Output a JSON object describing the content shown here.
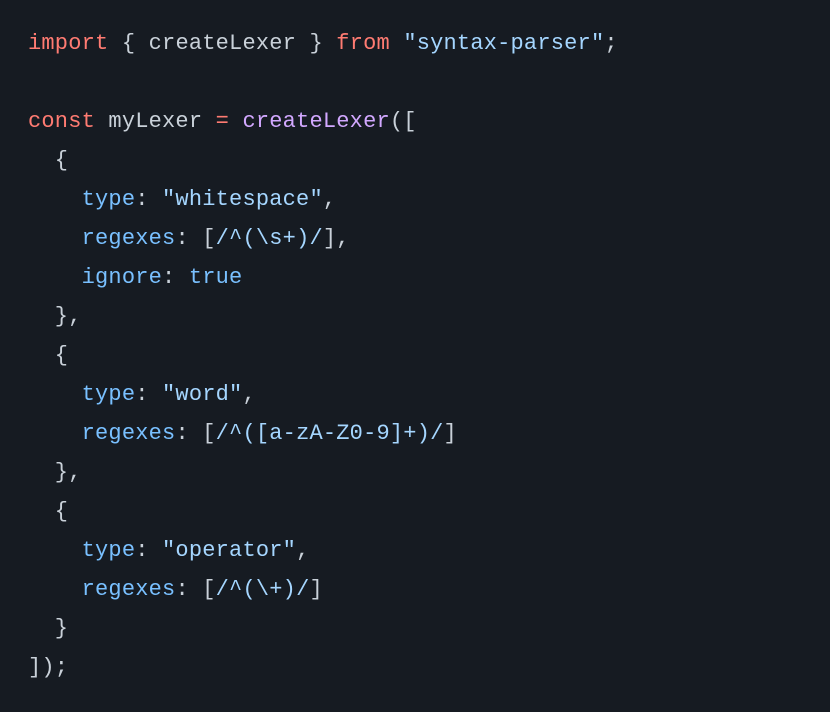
{
  "tokens": {
    "t0": "import",
    "t1": " { ",
    "t2": "createLexer",
    "t3": " } ",
    "t4": "from",
    "t5": " ",
    "t6": "\"syntax-parser\"",
    "t7": ";",
    "t8": "",
    "t9": "const",
    "t10": " ",
    "t11": "myLexer",
    "t12": " ",
    "t13": "=",
    "t14": " ",
    "t15": "createLexer",
    "t16": "([",
    "t17": "  {",
    "t18": "    ",
    "t19": "type",
    "t20": ": ",
    "t21": "\"whitespace\"",
    "t22": ",",
    "t23": "    ",
    "t24": "regexes",
    "t25": ": [",
    "t26": "/^(\\s+)/",
    "t27": "],",
    "t28": "    ",
    "t29": "ignore",
    "t30": ": ",
    "t31": "true",
    "t32": "  },",
    "t33": "  {",
    "t34": "    ",
    "t35": "type",
    "t36": ": ",
    "t37": "\"word\"",
    "t38": ",",
    "t39": "    ",
    "t40": "regexes",
    "t41": ": [",
    "t42": "/^([a-zA-Z0-9]+)/",
    "t43": "]",
    "t44": "  },",
    "t45": "  {",
    "t46": "    ",
    "t47": "type",
    "t48": ": ",
    "t49": "\"operator\"",
    "t50": ",",
    "t51": "    ",
    "t52": "regexes",
    "t53": ": [",
    "t54": "/^(\\+)/",
    "t55": "]",
    "t56": "  }",
    "t57": "]);"
  }
}
